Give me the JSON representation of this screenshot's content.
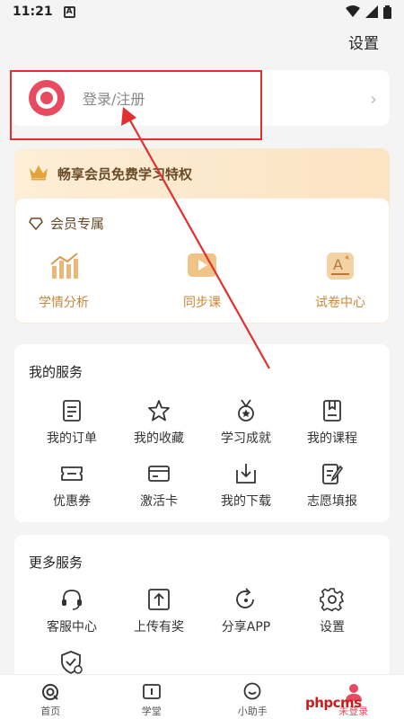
{
  "status_bar": {
    "time": "11:21",
    "badge": "A"
  },
  "header": {
    "settings_label": "设置"
  },
  "login": {
    "label": "登录/注册"
  },
  "vip": {
    "banner_title": "畅享会员免费学习特权",
    "section_title": "会员专属",
    "items": [
      {
        "label": "学情分析",
        "icon": "chart-icon"
      },
      {
        "label": "同步课",
        "icon": "video-icon"
      },
      {
        "label": "试卷中心",
        "icon": "exam-icon"
      }
    ]
  },
  "my_services": {
    "title": "我的服务",
    "items": [
      {
        "label": "我的订单",
        "icon": "order-icon"
      },
      {
        "label": "我的收藏",
        "icon": "star-icon"
      },
      {
        "label": "学习成就",
        "icon": "medal-icon"
      },
      {
        "label": "我的课程",
        "icon": "course-icon"
      },
      {
        "label": "优惠券",
        "icon": "coupon-icon"
      },
      {
        "label": "激活卡",
        "icon": "card-icon"
      },
      {
        "label": "我的下载",
        "icon": "download-icon"
      },
      {
        "label": "志愿填报",
        "icon": "edit-doc-icon"
      }
    ]
  },
  "more_services": {
    "title": "更多服务",
    "items": [
      {
        "label": "客服中心",
        "icon": "headset-icon"
      },
      {
        "label": "上传有奖",
        "icon": "upload-icon"
      },
      {
        "label": "分享APP",
        "icon": "share-icon"
      },
      {
        "label": "设置",
        "icon": "gear-icon"
      }
    ]
  },
  "tabs": [
    {
      "label": "首页",
      "icon": "home-icon"
    },
    {
      "label": "学堂",
      "icon": "school-icon"
    },
    {
      "label": "小助手",
      "icon": "chat-icon"
    },
    {
      "label": "未登录",
      "icon": "profile-icon"
    }
  ],
  "watermark": "phpcms",
  "colors": {
    "accent": "#e84a5f",
    "gold": "#c8873a",
    "annotation": "#e03030"
  }
}
